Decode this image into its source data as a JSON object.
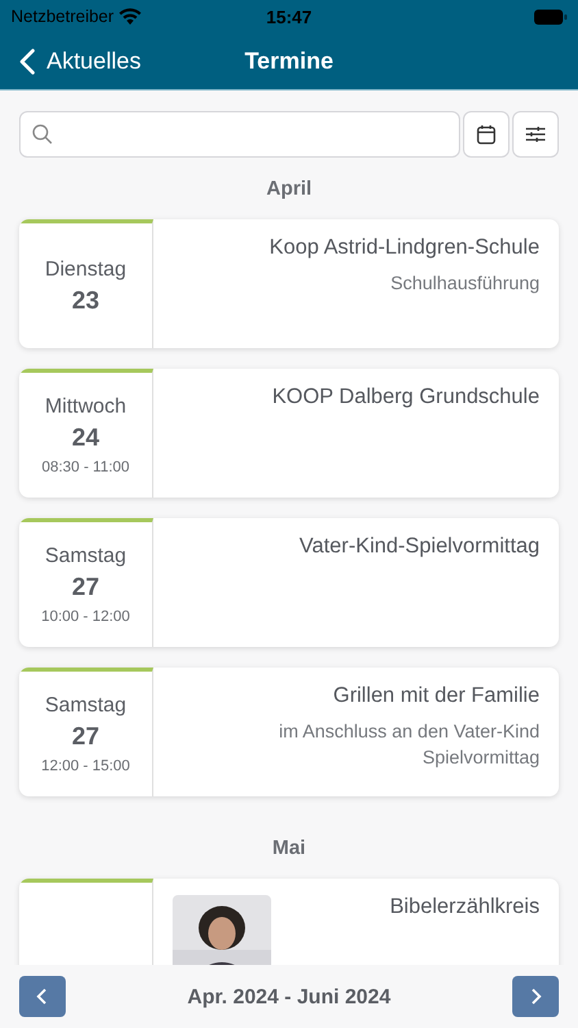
{
  "status_bar": {
    "carrier": "Netzbetreiber",
    "time": "15:47"
  },
  "nav": {
    "back_label": "Aktuelles",
    "title": "Termine"
  },
  "sections": [
    {
      "month": "April",
      "events": [
        {
          "weekday": "Dienstag",
          "day": "23",
          "title": "Koop Astrid-Lindgren-Schule",
          "subtitle": "Schulhausführung"
        },
        {
          "weekday": "Mittwoch",
          "day": "24",
          "time": "08:30 - 11:00",
          "title": "KOOP Dalberg Grundschule"
        },
        {
          "weekday": "Samstag",
          "day": "27",
          "time": "10:00 - 12:00",
          "title": "Vater-Kind-Spielvormittag"
        },
        {
          "weekday": "Samstag",
          "day": "27",
          "time": "12:00 - 15:00",
          "title": "Grillen mit der Familie",
          "subtitle": "im Anschluss an den Vater-Kind Spielvormittag"
        }
      ]
    },
    {
      "month": "Mai",
      "events": [
        {
          "title": "Bibelerzählkreis"
        }
      ]
    }
  ],
  "footer": {
    "range": "Apr. 2024 - Juni 2024"
  }
}
